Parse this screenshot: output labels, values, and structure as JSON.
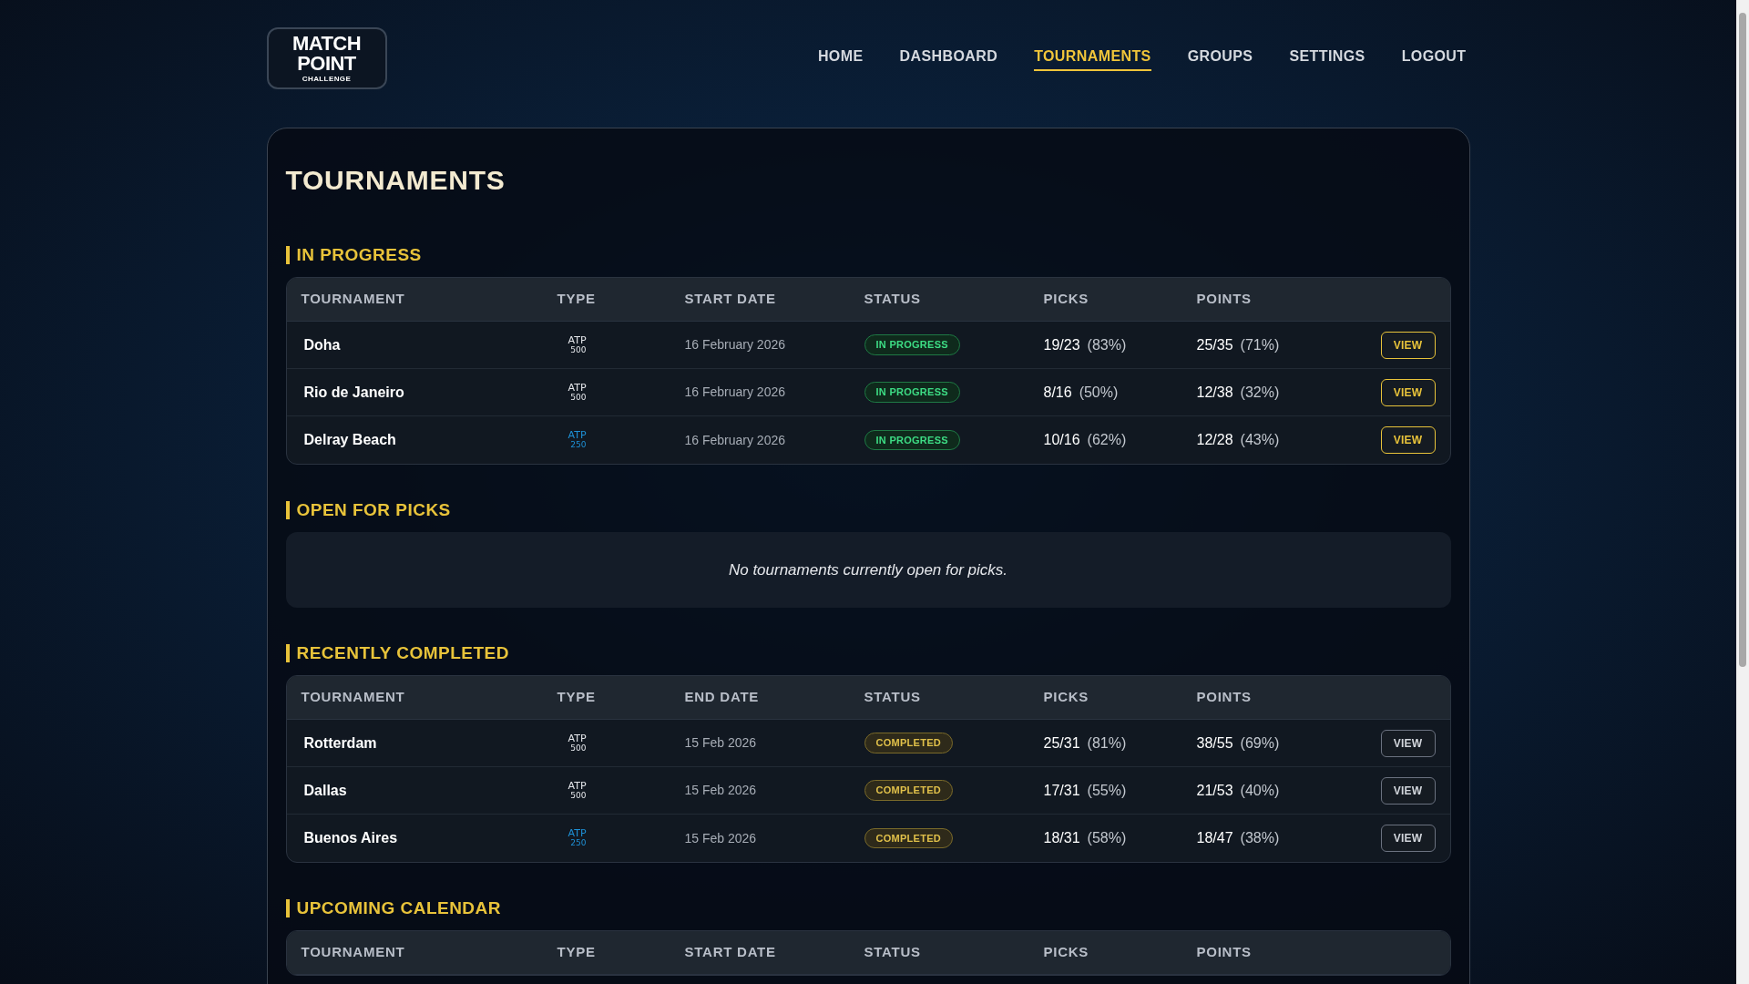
{
  "logo": {
    "line1": "MATCH",
    "line2": "POINT",
    "line3": "CHALLENGE"
  },
  "nav": [
    {
      "label": "HOME",
      "selected": false
    },
    {
      "label": "DASHBOARD",
      "selected": false
    },
    {
      "label": "TOURNAMENTS",
      "selected": true
    },
    {
      "label": "GROUPS",
      "selected": false
    },
    {
      "label": "SETTINGS",
      "selected": false
    },
    {
      "label": "LOGOUT",
      "selected": false
    }
  ],
  "page_title": "TOURNAMENTS",
  "sections": [
    {
      "title": "IN PROGRESS",
      "kind": "table",
      "columns": [
        "TOURNAMENT",
        "TYPE",
        "START DATE",
        "STATUS",
        "PICKS",
        "POINTS"
      ],
      "rows": [
        {
          "name": "Doha",
          "type": {
            "kind": "atp500",
            "label": "ATP",
            "tier": "500"
          },
          "date": "16 February 2026",
          "status": {
            "kind": "in_progress",
            "label": "IN PROGRESS"
          },
          "picks": "19/23",
          "picks_pct": "(83%)",
          "points": "25/35",
          "points_pct": "(71%)",
          "action": "VIEW"
        },
        {
          "name": "Rio de Janeiro",
          "type": {
            "kind": "atp500",
            "label": "ATP",
            "tier": "500"
          },
          "date": "16 February 2026",
          "status": {
            "kind": "in_progress",
            "label": "IN PROGRESS"
          },
          "picks": "8/16",
          "picks_pct": "(50%)",
          "points": "12/38",
          "points_pct": "(32%)",
          "action": "VIEW"
        },
        {
          "name": "Delray Beach",
          "type": {
            "kind": "atp250",
            "label": "ATP",
            "tier": "250"
          },
          "date": "16 February 2026",
          "status": {
            "kind": "in_progress",
            "label": "IN PROGRESS"
          },
          "picks": "10/16",
          "picks_pct": "(62%)",
          "points": "12/28",
          "points_pct": "(43%)",
          "action": "VIEW"
        }
      ]
    },
    {
      "title": "OPEN FOR PICKS",
      "kind": "empty",
      "message": "No tournaments currently open for picks."
    },
    {
      "title": "RECENTLY COMPLETED",
      "kind": "table",
      "columns": [
        "TOURNAMENT",
        "TYPE",
        "END DATE",
        "STATUS",
        "PICKS",
        "POINTS"
      ],
      "rows": [
        {
          "name": "Rotterdam",
          "type": {
            "kind": "atp500",
            "label": "ATP",
            "tier": "500"
          },
          "date": "15 Feb 2026",
          "status": {
            "kind": "completed",
            "label": "COMPLETED"
          },
          "picks": "25/31",
          "picks_pct": "(81%)",
          "points": "38/55",
          "points_pct": "(69%)",
          "action": "VIEW"
        },
        {
          "name": "Dallas",
          "type": {
            "kind": "atp500",
            "label": "ATP",
            "tier": "500"
          },
          "date": "15 Feb 2026",
          "status": {
            "kind": "completed",
            "label": "COMPLETED"
          },
          "picks": "17/31",
          "picks_pct": "(55%)",
          "points": "21/53",
          "points_pct": "(40%)",
          "action": "VIEW"
        },
        {
          "name": "Buenos Aires",
          "type": {
            "kind": "atp250",
            "label": "ATP",
            "tier": "250"
          },
          "date": "15 Feb 2026",
          "status": {
            "kind": "completed",
            "label": "COMPLETED"
          },
          "picks": "18/31",
          "picks_pct": "(58%)",
          "points": "18/47",
          "points_pct": "(38%)",
          "action": "VIEW"
        }
      ]
    },
    {
      "title": "UPCOMING CALENDAR",
      "kind": "table",
      "columns": [
        "TOURNAMENT",
        "TYPE",
        "START DATE",
        "STATUS",
        "PICKS",
        "POINTS"
      ]
    }
  ]
}
